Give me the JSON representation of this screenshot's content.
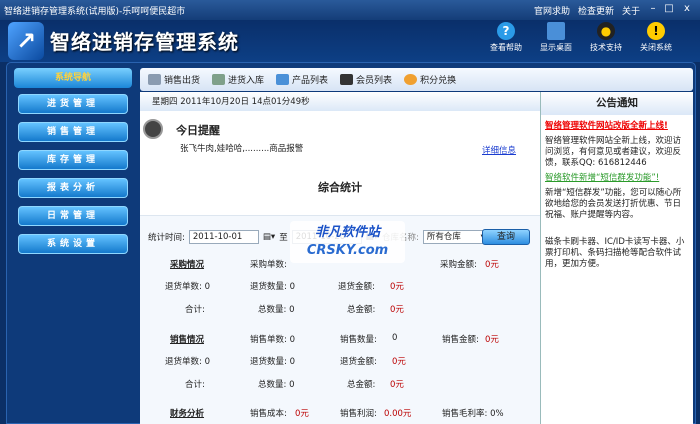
{
  "window": {
    "title": "智络进销存管理系统(试用版)-乐呵呵便民超市",
    "links": [
      "官网求助",
      "检查更新",
      "关于"
    ]
  },
  "header": {
    "app_title": "智络进销存管理系统",
    "buttons": [
      "查看帮助",
      "显示桌面",
      "技术支持",
      "关闭系统"
    ]
  },
  "sidebar": {
    "heading": "系统导航",
    "items": [
      "进货管理",
      "销售管理",
      "库存管理",
      "报表分析",
      "日常管理",
      "系统设置"
    ]
  },
  "toolbar": {
    "items": [
      "销售出货",
      "进货入库",
      "产品列表",
      "会员列表",
      "积分兑换"
    ]
  },
  "datebar": {
    "text": "星期四   2011年10月20日  14点01分49秒"
  },
  "reminder": {
    "title": "今日提醒",
    "text": "张飞牛肉,娃哈哈,.........商品报警",
    "detail_link": "详细信息"
  },
  "summary": {
    "title": "综合统计",
    "filter": {
      "label": "统计时间:",
      "start": "2011-10-01",
      "to": "至",
      "end": "2011-10-20",
      "warehouse_label": "仓库名称:",
      "warehouse": "所有仓库",
      "query": "查询"
    },
    "purchase": {
      "title": "采购情况",
      "count_label": "采购单数:",
      "amount_label": "采购金额:",
      "amount": "0元",
      "ret_count": "退货单数: 0",
      "ret_qty": "退货数量: 0",
      "ret_amount_label": "退货金额:",
      "ret_amount": "0元",
      "total": "合计:",
      "total_qty": "总数量: 0",
      "total_amount_label": "总金额:",
      "total_amount": "0元"
    },
    "sales": {
      "title": "销售情况",
      "count": "销售单数: 0",
      "qty_label": "销售数量:",
      "qty": "0",
      "amount_label": "销售金额:",
      "amount": "0元",
      "ret_count": "退货单数: 0",
      "ret_qty": "退货数量: 0",
      "ret_amount_label": "退货金额:",
      "ret_amount": "0元",
      "total": "合计:",
      "total_qty": "总数量: 0",
      "total_amount_label": "总金额:",
      "total_amount": "0元"
    },
    "finance": {
      "title": "财务分析",
      "cost_label": "销售成本:",
      "cost": "0元",
      "profit_label": "销售利润:",
      "profit": "0.00元",
      "margin": "销售毛利率: 0%"
    }
  },
  "watermark": {
    "line1": "非凡软件站",
    "line2": "CRSKY.com"
  },
  "notice": {
    "title": "公告通知",
    "items": [
      {
        "head": "智络管理软件网站改版全新上线!",
        "body": "智络管理软件网站全新上线，欢迎访问浏览，有何意见或者建议，欢迎反馈，联系QQ: 616812446"
      },
      {
        "head": "智络软件新增“短信群发功能”!",
        "body": "新增“短信群发”功能，您可以随心所欲地给您的会员发送打折优惠、节日祝福、账户提醒等内容。"
      },
      {
        "head": "",
        "body": "磁条卡刷卡器、IC/ID卡读写卡器、小票打印机、条码扫描枪等配合软件试用，更加方便。"
      }
    ]
  }
}
